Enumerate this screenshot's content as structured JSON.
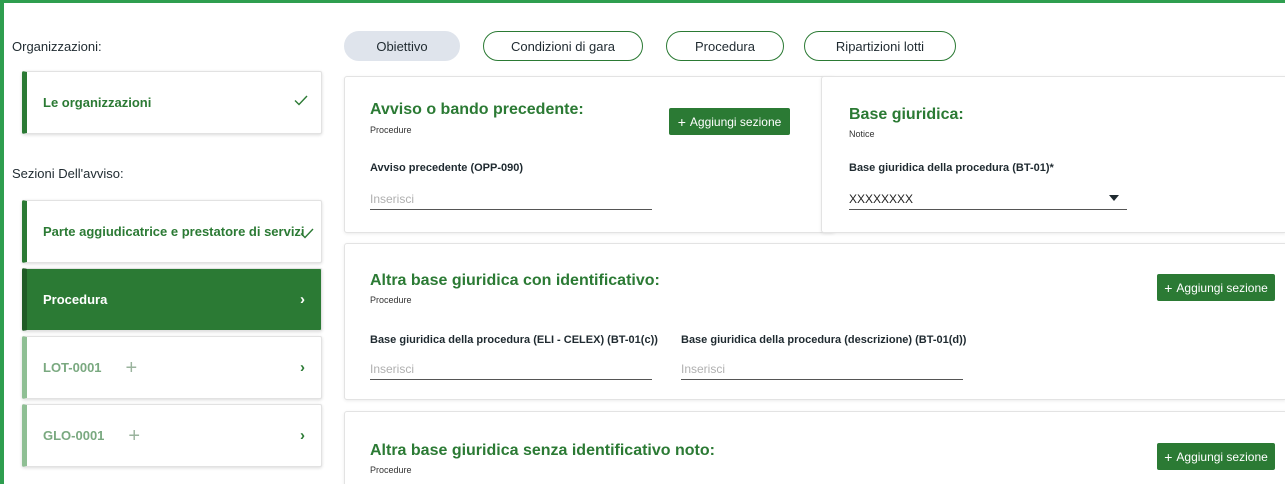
{
  "sidebar": {
    "org_heading": "Organizzazioni:",
    "org_item": "Le organizzazioni",
    "sections_heading": "Sezioni Dell'avviso:",
    "items": [
      {
        "label": "Parte aggiudicatrice e prestatore di servizi"
      },
      {
        "label": "Procedura"
      },
      {
        "label": "LOT-0001"
      },
      {
        "label": "GLO-0001"
      }
    ]
  },
  "tabs": [
    "Obiettivo",
    "Condizioni di gara",
    "Procedura",
    "Ripartizioni lotti"
  ],
  "cards": {
    "avviso": {
      "title": "Avviso o bando precedente:",
      "sub": "Procedure",
      "button": "Aggiungi sezione",
      "field_label": "Avviso precedente (OPP-090)",
      "placeholder": "Inserisci"
    },
    "base": {
      "title": "Base giuridica:",
      "sub": "Notice",
      "field_label": "Base giuridica della procedura (BT-01)*",
      "value": "XXXXXXXX"
    },
    "altra_con": {
      "title": "Altra base giuridica con identificativo:",
      "sub": "Procedure",
      "button": "Aggiungi sezione",
      "field1_label": "Base giuridica della procedura (ELI - CELEX) (BT-01(c))",
      "field2_label": "Base giuridica della procedura (descrizione) (BT-01(d))",
      "placeholder": "Inserisci"
    },
    "altra_senza": {
      "title": "Altra base giuridica senza identificativo noto:",
      "sub": "Procedure",
      "button": "Aggiungi sezione"
    }
  },
  "colors": {
    "accent": "#2b7a34",
    "frame": "#2e9e4f",
    "tab_selected": "#dfe4ec"
  }
}
